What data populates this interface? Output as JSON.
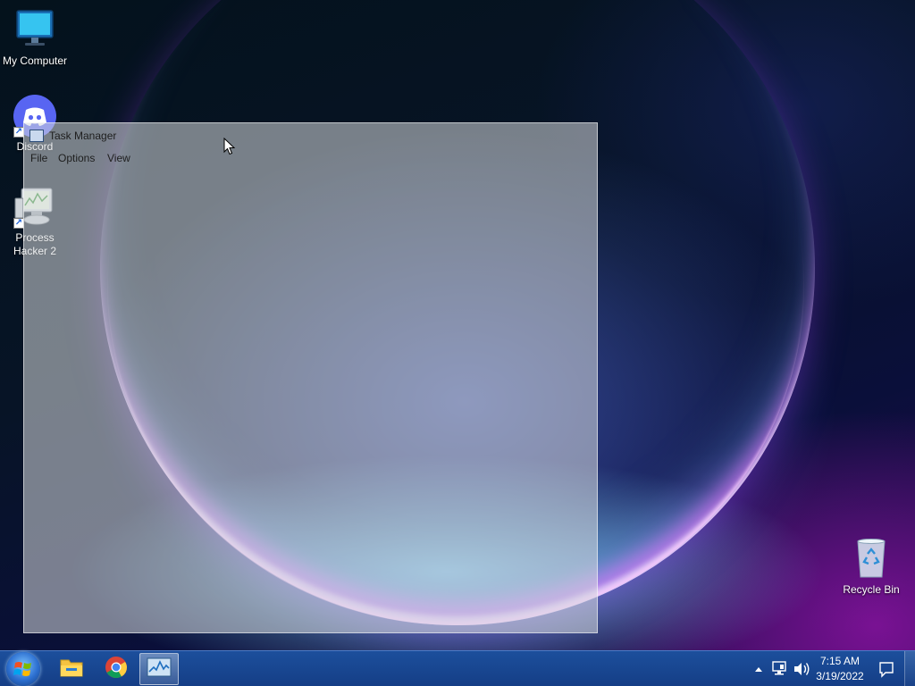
{
  "desktop": {
    "icons": [
      {
        "label": "My Computer",
        "icon": "monitor-icon"
      },
      {
        "label": "Discord",
        "icon": "discord-icon",
        "shortcut": true
      },
      {
        "label": "Process Hacker 2",
        "icon": "process-hacker-icon",
        "shortcut": true
      },
      {
        "label": "Recycle Bin",
        "icon": "recycle-bin-icon"
      }
    ]
  },
  "window": {
    "title": "Task Manager",
    "menu": [
      "File",
      "Options",
      "View"
    ]
  },
  "taskbar": {
    "pinned": [
      {
        "icon": "start-orb-icon"
      },
      {
        "icon": "file-explorer-icon"
      },
      {
        "icon": "chrome-icon"
      },
      {
        "icon": "task-manager-icon",
        "active": true
      }
    ],
    "tray": {
      "icons": [
        "show-hidden-icons-arrow",
        "network-icon",
        "volume-icon",
        "action-center-icon"
      ],
      "time": "7:15 AM",
      "date": "3/19/2022"
    }
  },
  "colors": {
    "taskbar": "#1c4f9c",
    "discord": "#5865f2",
    "accent_wallpaper": "#8a2be2"
  }
}
